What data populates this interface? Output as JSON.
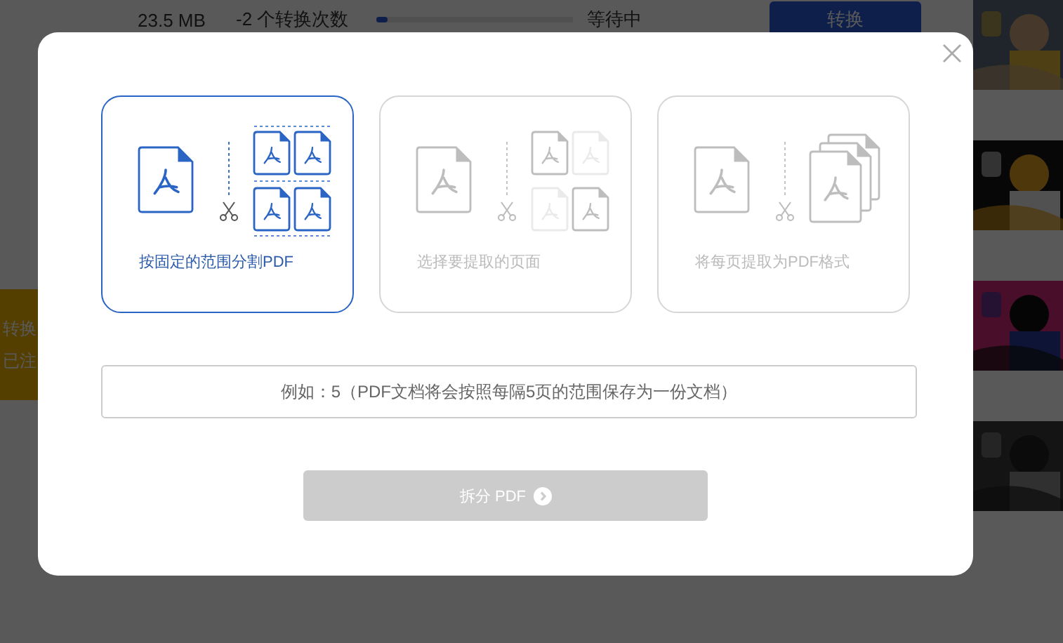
{
  "background": {
    "file_row": {
      "size": "23.5 MB",
      "conversions": "-2 个转换次数",
      "progress": {
        "level": 0.03
      },
      "status": "等待中",
      "button": "转换"
    },
    "banner": {
      "lines": [
        "转换",
        "已注"
      ]
    }
  },
  "dialog": {
    "options": [
      {
        "kind": "fixed",
        "label": "按固定的范围分割PDF",
        "selected": true
      },
      {
        "kind": "select",
        "label": "选择要提取的页面",
        "selected": false
      },
      {
        "kind": "each",
        "label": "将每页提取为PDF格式",
        "selected": false
      }
    ],
    "input": {
      "placeholder": "例如：5（PDF文档将会按照每隔5页的范围保存为一份文档）"
    },
    "submit": {
      "label": "拆分 PDF",
      "disabled": true
    }
  }
}
